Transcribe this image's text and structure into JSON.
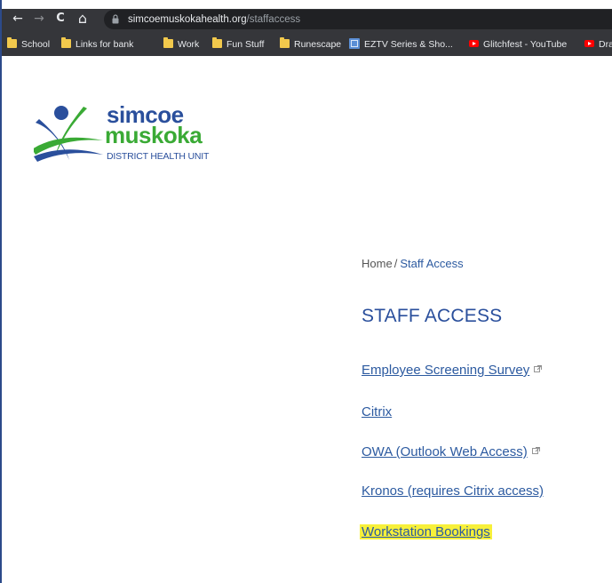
{
  "browser": {
    "url_host": "simcoemuskokahealth.org",
    "url_path": "/staffaccess",
    "nav": {
      "back": "←",
      "forward": "→",
      "reload": "C",
      "home": "⌂"
    },
    "bookmarks": [
      {
        "label": "School",
        "icon": "folder-icon"
      },
      {
        "label": "Links for bank",
        "icon": "folder-icon"
      },
      {
        "label": "Work",
        "icon": "folder-icon"
      },
      {
        "label": "Fun Stuff",
        "icon": "folder-icon"
      },
      {
        "label": "Runescape",
        "icon": "folder-icon"
      },
      {
        "label": "EZTV Series & Sho...",
        "icon": "eztv-icon"
      },
      {
        "label": "Glitchfest - YouTube",
        "icon": "youtube-icon"
      },
      {
        "label": "Dra",
        "icon": "youtube-icon"
      }
    ]
  },
  "logo": {
    "line1": "simcoe",
    "line2": "muskoka",
    "line3": "DISTRICT HEALTH UNIT"
  },
  "breadcrumb": {
    "home": "Home",
    "separator": "/",
    "current": "Staff Access"
  },
  "page": {
    "title": "STAFF ACCESS",
    "links": [
      {
        "label": "Employee Screening Survey",
        "external": true
      },
      {
        "label": "Citrix",
        "external": false
      },
      {
        "label": "OWA (Outlook Web Access)",
        "external": true
      },
      {
        "label": "Kronos (requires Citrix access)",
        "external": false
      },
      {
        "label": "Workstation Bookings",
        "external": false,
        "highlighted": true
      }
    ]
  },
  "colors": {
    "brand_blue": "#2a4f9c",
    "brand_green": "#3aaa35",
    "link_blue": "#2c5aa0",
    "highlight": "#f7f03a",
    "chrome_bg": "#35363a"
  }
}
